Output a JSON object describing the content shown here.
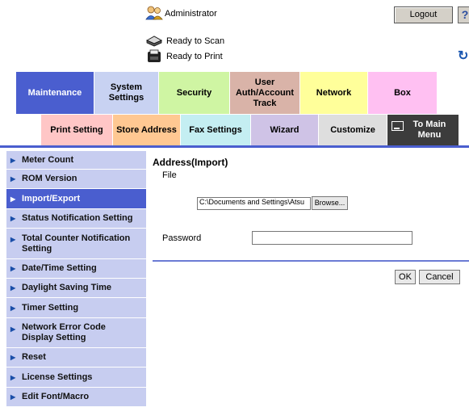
{
  "header": {
    "user": {
      "icon": "users-icon",
      "label": "Administrator"
    },
    "logout_label": "Logout",
    "help_icon": "help-icon",
    "status": [
      {
        "icon": "scanner-icon",
        "label": "Ready to Scan"
      },
      {
        "icon": "printer-icon",
        "label": "Ready to Print"
      }
    ],
    "refresh_icon": "refresh-icon"
  },
  "main_tabs": [
    {
      "label": "Maintenance",
      "color": "#4a5ecf",
      "text_color": "#ffffff",
      "active": true
    },
    {
      "label": "System Settings",
      "color": "#c8d2f2",
      "text_color": "#000000"
    },
    {
      "label": "Security",
      "color": "#cff5a3",
      "text_color": "#000000"
    },
    {
      "label": "User Auth/Account Track",
      "color": "#d9b3a8",
      "text_color": "#000000"
    },
    {
      "label": "Network",
      "color": "#ffff9a",
      "text_color": "#000000"
    },
    {
      "label": "Box",
      "color": "#ffc0f2",
      "text_color": "#000000"
    }
  ],
  "sub_tabs": [
    {
      "label": "Print Setting",
      "color": "#ffc6c6"
    },
    {
      "label": "Store Address",
      "color": "#ffc892"
    },
    {
      "label": "Fax Settings",
      "color": "#c4eef2"
    },
    {
      "label": "Wizard",
      "color": "#cfc3e6"
    },
    {
      "label": "Customize",
      "color": "#dedede"
    },
    {
      "label": "To Main Menu",
      "color": "#3c3c3c",
      "icon": "main-menu-icon"
    }
  ],
  "side_menu": [
    {
      "label": "Meter Count"
    },
    {
      "label": "ROM Version"
    },
    {
      "label": "Import/Export",
      "active": true
    },
    {
      "label": "Status Notification Setting"
    },
    {
      "label": "Total Counter Notification Setting"
    },
    {
      "label": "Date/Time Setting"
    },
    {
      "label": "Daylight Saving Time"
    },
    {
      "label": "Timer Setting"
    },
    {
      "label": "Network Error Code Display Setting"
    },
    {
      "label": "Reset"
    },
    {
      "label": "License Settings"
    },
    {
      "label": "Edit Font/Macro"
    }
  ],
  "content": {
    "title": "Address(Import)",
    "file_label": "File",
    "file_value": "C:\\Documents and Settings\\Atsu",
    "browse_label": "Browse...",
    "password_label": "Password",
    "password_value": "",
    "ok_label": "OK",
    "cancel_label": "Cancel"
  }
}
